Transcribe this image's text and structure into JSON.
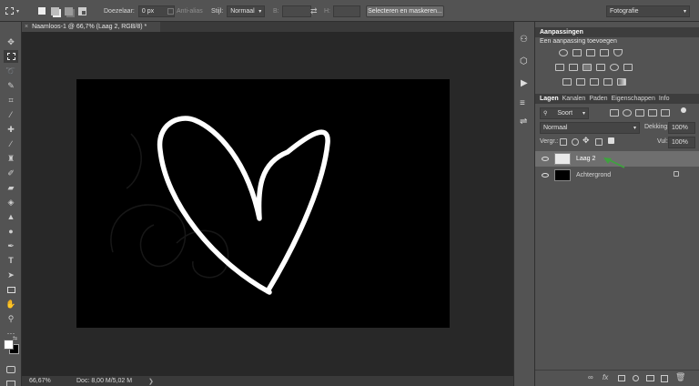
{
  "options_bar": {
    "feather_label": "Doezelaar:",
    "feather_value": "0 px",
    "antialias_label": "Anti-alias",
    "style_label": "Stijl:",
    "style_value": "Normaal",
    "width_label": "B:",
    "height_label": "H:",
    "select_mask_button": "Selecteren en maskeren...",
    "workspace_value": "Fotografie"
  },
  "document_tab": {
    "title": "Naamloos-1 @ 66,7% (Laag 2, RGB/8) *",
    "close": "×"
  },
  "status_bar": {
    "zoom": "66,67%",
    "doc_info": "Doc: 8,00 M/5,02 M",
    "arrow": "❯"
  },
  "adjustments_panel": {
    "title": "Aanpassingen",
    "subtitle": "Een aanpassing toevoegen"
  },
  "layers_panel": {
    "tabs": [
      "Lagen",
      "Kanalen",
      "Paden",
      "Eigenschappen",
      "Info"
    ],
    "filter_value": "Soort",
    "blend_mode": "Normaal",
    "opacity_label": "Dekking:",
    "opacity_value": "100%",
    "lock_label": "Vergr.:",
    "fill_label": "Vul:",
    "fill_value": "100%",
    "layers": [
      {
        "name": "Laag 2",
        "selected": true
      },
      {
        "name": "Achtergrond",
        "selected": false
      }
    ]
  },
  "colors": {
    "foreground": "#ffffff",
    "background": "#000000",
    "annotation_arrow": "#3ea33e"
  }
}
